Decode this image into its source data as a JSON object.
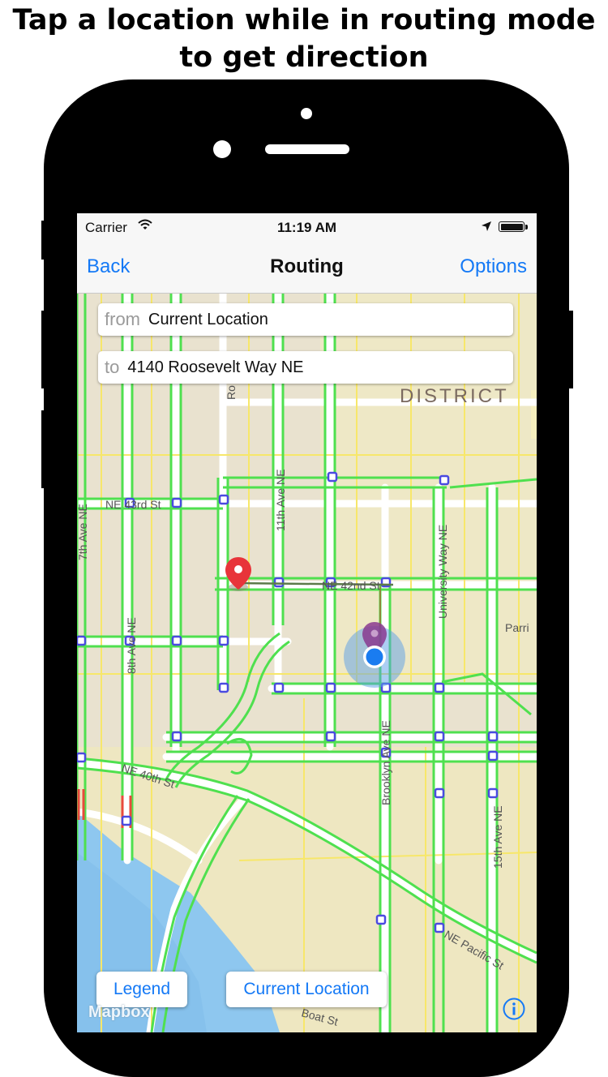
{
  "headline": {
    "line1": "Tap a location while in routing mode",
    "line2": "to get direction"
  },
  "status_bar": {
    "carrier": "Carrier",
    "time": "11:19 AM"
  },
  "nav": {
    "back": "Back",
    "title": "Routing",
    "options": "Options"
  },
  "route": {
    "from_label": "from",
    "from_value": "Current Location",
    "to_label": "to",
    "to_value": "4140 Roosevelt Way NE"
  },
  "buttons": {
    "legend": "Legend",
    "current_location": "Current Location"
  },
  "attribution": "Mapbox",
  "map_labels": {
    "district": "DISTRICT",
    "ne_43rd": "NE 43rd St",
    "ne_42nd": "NE 42nd St",
    "ne_40th": "NE 40th St",
    "ave_11th": "11th Ave NE",
    "ave_8th": "8th Ave NE",
    "ave_7th": "7th Ave NE",
    "ave_15th": "15th Ave NE",
    "university_way": "University Way NE",
    "brooklyn": "Brooklyn Ave NE",
    "pacific": "NE Pacific St",
    "park": "Parri",
    "roosevelt_partial": "Ro",
    "boat": "Boat St"
  },
  "colors": {
    "accent": "#1479f6",
    "bike_route": "#4fe04f",
    "pin_red": "#e8343a",
    "pin_purple": "#8a3a8f",
    "user_dot": "#1a7cf0",
    "water": "#8ec7ef",
    "land": "#ede4cc"
  }
}
